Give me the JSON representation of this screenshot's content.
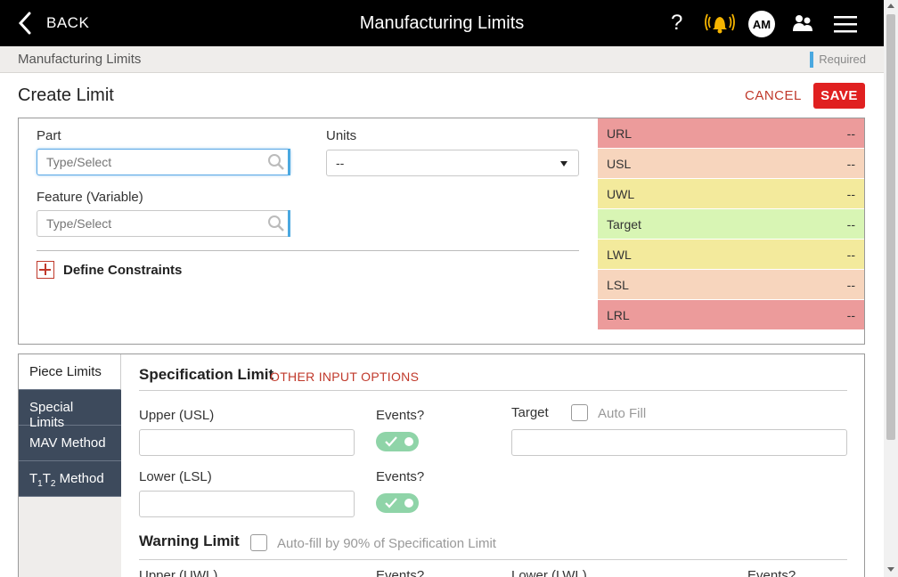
{
  "topbar": {
    "back_label": "BACK",
    "title": "Manufacturing Limits",
    "help_glyph": "?",
    "avatar_initials": "AM",
    "icons": [
      "chevron-left-icon",
      "help-icon",
      "bell-alert-icon",
      "users-icon",
      "hamburger-menu-icon"
    ]
  },
  "breadcrumb": {
    "text": "Manufacturing Limits",
    "required_label": "Required"
  },
  "page": {
    "title": "Create Limit",
    "cancel_label": "CANCEL",
    "save_label": "SAVE"
  },
  "form": {
    "part_label": "Part",
    "part_placeholder": "Type/Select",
    "units_label": "Units",
    "units_value": "--",
    "feature_label": "Feature (Variable)",
    "feature_placeholder": "Type/Select",
    "define_constraints": "Define Constraints"
  },
  "limits": [
    {
      "label": "URL",
      "value": "--",
      "color": "#ec9b9b"
    },
    {
      "label": "USL",
      "value": "--",
      "color": "#f7d5bd"
    },
    {
      "label": "UWL",
      "value": "--",
      "color": "#f3ea9c"
    },
    {
      "label": "Target",
      "value": "--",
      "color": "#d8f5b4"
    },
    {
      "label": "LWL",
      "value": "--",
      "color": "#f3ea9c"
    },
    {
      "label": "LSL",
      "value": "--",
      "color": "#f7d5bd"
    },
    {
      "label": "LRL",
      "value": "--",
      "color": "#ec9b9b"
    }
  ],
  "tabs": [
    "Piece Limits",
    "Special Limits",
    "MAV Method",
    "T",
    "1",
    "T",
    "2",
    " Method"
  ],
  "spec": {
    "title": "Specification Limit",
    "other_options": "OTHER INPUT OPTIONS",
    "upper_label": "Upper (USL)",
    "lower_label": "Lower (LSL)",
    "events_label": "Events?",
    "target_label": "Target",
    "autofill_label": "Auto Fill"
  },
  "warning": {
    "title": "Warning Limit",
    "autofill_label": "Auto-fill by 90% of Specification Limit",
    "upper_label": "Upper (UWL)",
    "lower_label": "Lower (LWL)",
    "events_label": "Events?"
  },
  "colors": {
    "accent_red": "#e02020",
    "topbar": "#000000",
    "tab_dark": "#3d4a5c",
    "toggle_green": "#8fd4a8"
  }
}
